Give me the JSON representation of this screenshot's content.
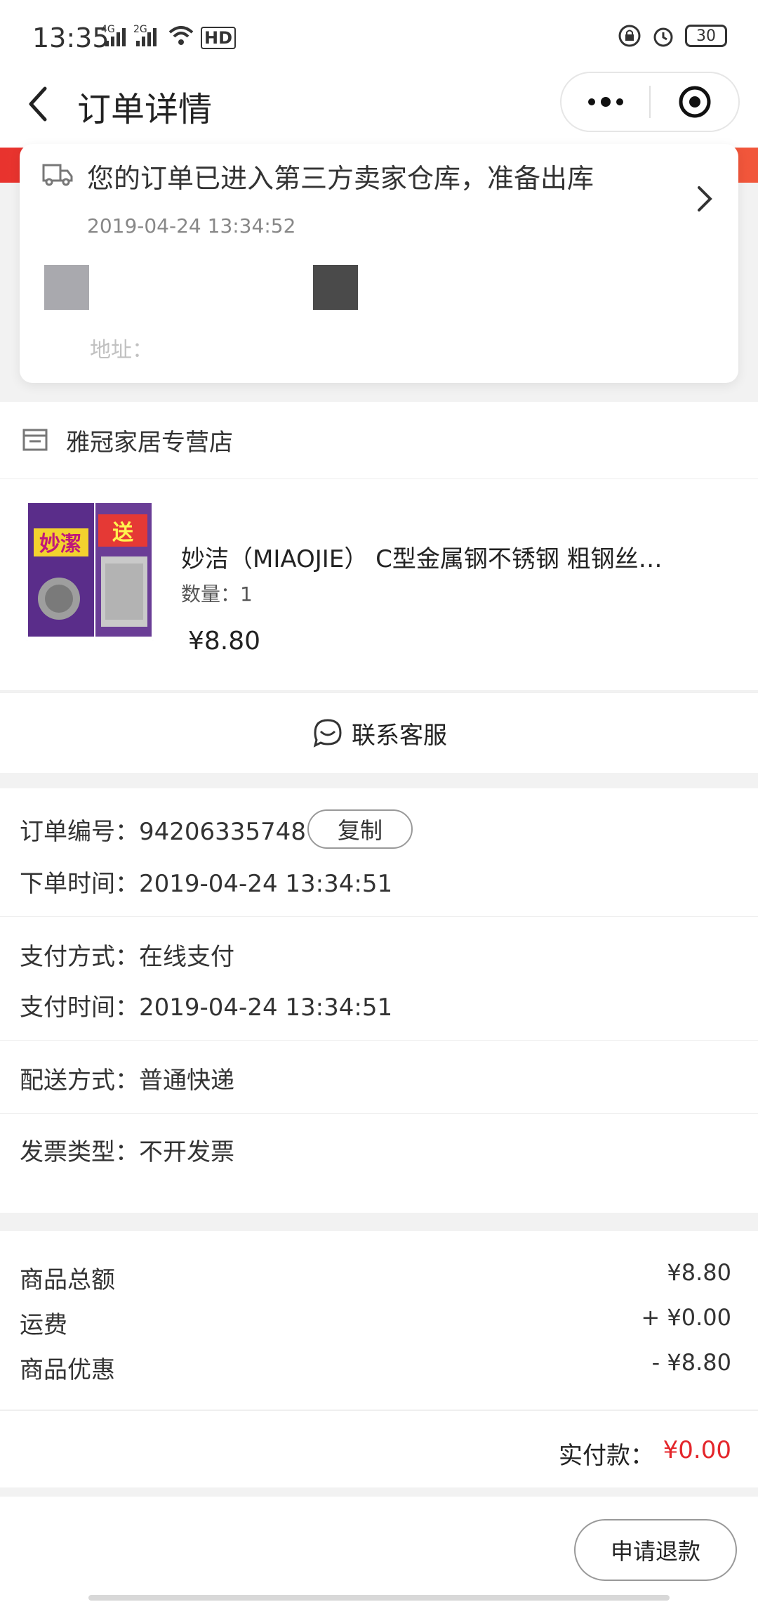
{
  "status_bar": {
    "time": "13:35",
    "net1": "4G",
    "net2": "2G",
    "hd": "HD",
    "battery": "30"
  },
  "nav": {
    "title": "订单详情"
  },
  "logistics": {
    "message": "您的订单已进入第三方卖家仓库，准备出库",
    "time": "2019-04-24 13:34:52",
    "address_label": "地址："
  },
  "shop": {
    "name": "雅冠家居专营店"
  },
  "product": {
    "title": "妙洁（MIAOJIE） C型金属钢不锈钢 粗钢丝…",
    "quantity": "数量：1",
    "price": "¥8.80",
    "image_text_brand": "妙潔",
    "image_text_promo": "送"
  },
  "service": {
    "label": "联系客服"
  },
  "order_info": {
    "order_no_label": "订单编号：94206335748",
    "copy_label": "复制",
    "order_time": "下单时间：2019-04-24 13:34:51",
    "pay_method": "支付方式：在线支付",
    "pay_time": "支付时间：2019-04-24 13:34:51",
    "delivery": "配送方式：普通快递",
    "invoice": "发票类型：不开发票"
  },
  "price": {
    "goods_total_label": "商品总额",
    "goods_total": "¥8.80",
    "shipping_label": "运费",
    "shipping": "+ ¥0.00",
    "discount_label": "商品优惠",
    "discount": "- ¥8.80",
    "paid_label": "实付款：",
    "paid": "¥0.00"
  },
  "actions": {
    "refund": "申请退款"
  },
  "colors": {
    "accent_red": "#e4262b",
    "header_red": "#e8332e"
  }
}
